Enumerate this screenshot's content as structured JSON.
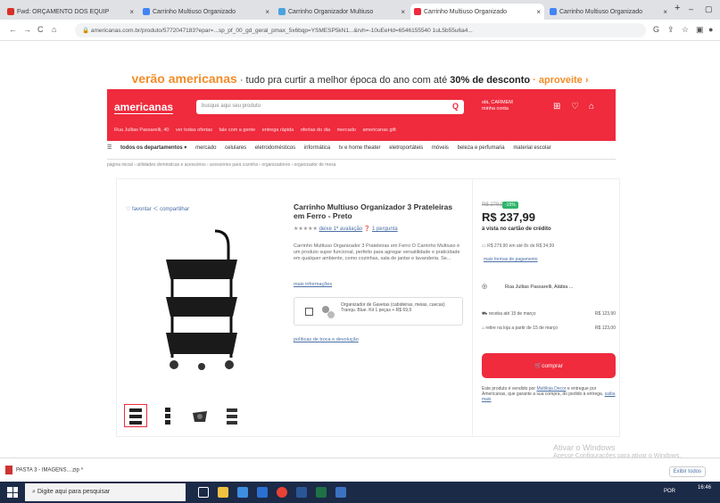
{
  "browser": {
    "tabs": [
      {
        "label": "Fwd: ORÇAMENTO DOS EQUIP",
        "active": false,
        "favicon_color": "#d93025"
      },
      {
        "label": "Carrinho Multiuso Organizado",
        "active": false,
        "favicon_color": "#4285f4"
      },
      {
        "label": "Carrinho Organizador Multiuso",
        "active": false,
        "favicon_color": "#4aa3df"
      },
      {
        "label": "Carrinho Multiuso Organizado",
        "active": true,
        "favicon_color": "#ef2b3d"
      },
      {
        "label": "Carrinho Multiuso Organizado",
        "active": false,
        "favicon_color": "#4285f4"
      }
    ],
    "new_tab": "+",
    "url": "americanas.com.br/produto/5772047183?epar=...sp_pf_00_gd_geral_pmax_5x6bqp=YSMESP5kN1...&rvh=-10uEeHd=6546155540 1uL5b55u6a4..."
  },
  "promo": {
    "brand": "verão americanas",
    "text": " · tudo pra curtir a melhor época do ano com até ",
    "highlight": "30% de desconto",
    "cta": " · aproveite ›"
  },
  "header": {
    "logo": "americanas",
    "search_placeholder": "busque aqui seu produto",
    "user_line1": "olá, CARMEM",
    "user_line2": "minha conta",
    "location": "Rua Jullias Passarelli, 40",
    "subnav": [
      "ver todas ofertas",
      "fale com a gente",
      "entrega rápida",
      "ofertas do dia",
      "mercado",
      "americanas gift"
    ]
  },
  "categories": {
    "all": "todos os departamentos",
    "items": [
      "mercado",
      "celulares",
      "eletrodomésticos",
      "informática",
      "tv e home theater",
      "eletroportáteis",
      "móveis",
      "beleza e perfumaria",
      "material escolar"
    ]
  },
  "breadcrumb": "página inicial › utilidades domésticas e acessórios › acessórios para cozinha › organizadores › organizador de mesa",
  "product": {
    "share_labels": [
      "favoritar",
      "compartilhar"
    ],
    "title": "Carrinho Multiuso Organizador 3 Prateleiras em Ferro - Preto",
    "rating_text": "deixe 1ª avaliação",
    "rating_question": "1 pergunta",
    "description": "Carrinho Multiuso Organizador 3 Prateleiras em Ferro O Carrinho Multiuso é um produto super funcional, perfeito para agregar versatilidade e praticidade em qualquer ambiente, como cozinhas, sala de jantar e lavanderia. Se...",
    "more_info": "mais informações",
    "kit_text": "Organizador de Gavetas (cabideiras, meias, cuecas) Tranqu. Blue. Kit 1 peças + R$ 69,9",
    "kit_link": "políticas de troca e devolução"
  },
  "buybox": {
    "old_price": "R$ 279,90",
    "discount": "-15%",
    "price": "R$ 237,99",
    "cash_label": "à vista no cartão de crédito",
    "installments": "R$ 279,90 em até 8x de R$ 34,99",
    "payment_link": "mais formas de pagamento",
    "store_name": "Rua Jullias Passarelli, Alábia ...",
    "shipping": [
      {
        "label": "receba até 15 de março",
        "value": "R$ 123,90"
      },
      {
        "label": "retire na loja a partir de 15 de março",
        "value": "R$ 123,00"
      }
    ],
    "buy_button": "comprar",
    "seller_prefix": "Este produto é vendido por ",
    "seller_name": "Multiloja Decor",
    "seller_suffix": " e entregue por Americanas, que garante a sua compra, do pedido à entrega. ",
    "seller_link": "saiba mais"
  },
  "system": {
    "activate_line1": "Ativar o Windows",
    "activate_line2": "Acesse Configurações para ativar o Windows.",
    "download_name": "PASTA 3 - IMAGENS....zip",
    "show_all": "Exibir todos",
    "search_placeholder": "Digite aqui para pesquisar",
    "lang": "POR",
    "time": "16:46"
  }
}
